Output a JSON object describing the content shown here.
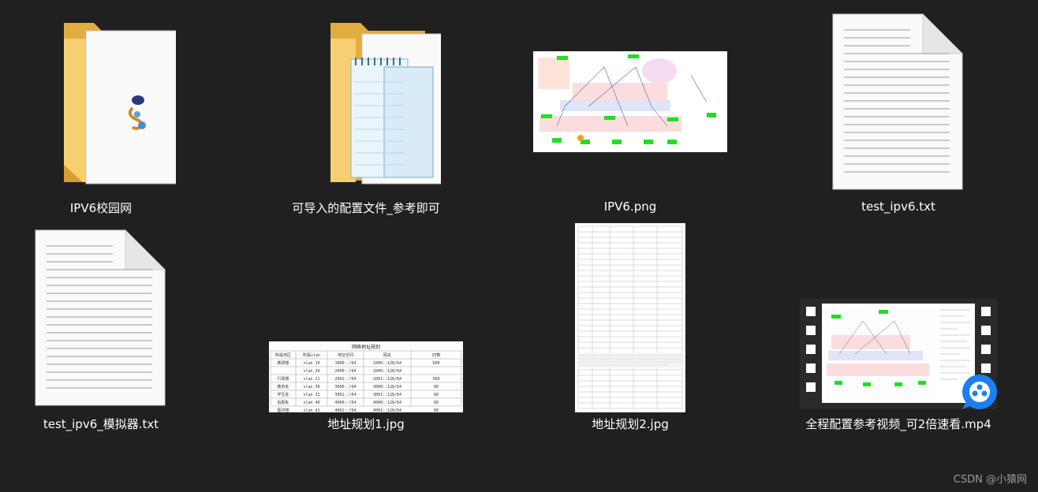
{
  "files": [
    {
      "name": "IPV6校园网",
      "kind": "folder-with-image"
    },
    {
      "name": "可导入的配置文件_参考即可",
      "kind": "folder-with-notepad"
    },
    {
      "name": "IPV6.png",
      "kind": "png"
    },
    {
      "name": "test_ipv6.txt",
      "kind": "txt"
    },
    {
      "name": "test_ipv6_模拟器.txt",
      "kind": "txt"
    },
    {
      "name": "地址规划1.jpg",
      "kind": "jpg-table"
    },
    {
      "name": "地址规划2.jpg",
      "kind": "jpg-long-table"
    },
    {
      "name": "全程配置参考视频_可2倍速看.mp4",
      "kind": "mp4"
    }
  ],
  "addr_table_1": {
    "title": "网络地址规划",
    "headers": [
      "所属地区",
      "所属vlan",
      "地址空间",
      "网关",
      "IP数"
    ],
    "rows": [
      [
        "教研楼",
        "vlan 10",
        "1000::/64",
        "1000::128/64",
        "600"
      ],
      [
        "",
        "vlan 20",
        "2000::/64",
        "2000::128/64",
        ""
      ],
      [
        "行政楼",
        "vlan 21",
        "2001::/64",
        "2001::128/64",
        "360"
      ],
      [
        "教务处",
        "vlan 30",
        "3000::/64",
        "3000::128/64",
        "80"
      ],
      [
        "学生处",
        "vlan 31",
        "3001::/64",
        "3001::128/64",
        "80"
      ],
      [
        "后勤处",
        "vlan 40",
        "4000::/64",
        "4000::128/64",
        "80"
      ],
      [
        "图书馆",
        "vlan 41",
        "4001::/64",
        "4001::128/64",
        "80"
      ]
    ]
  },
  "watermark": "CSDN @小猿网",
  "colors": {
    "background": "#202020",
    "text": "#ffffff",
    "folder": "#f0c35e"
  }
}
